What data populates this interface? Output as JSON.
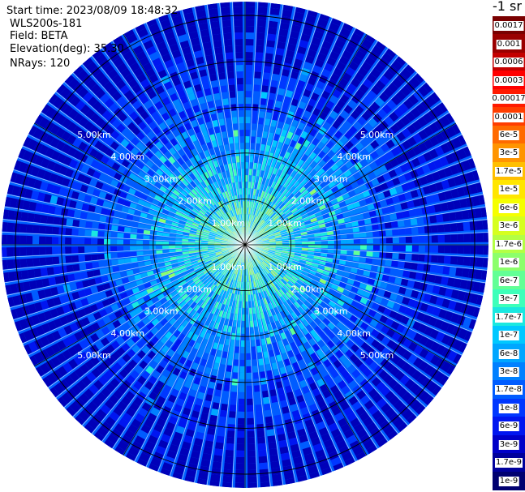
{
  "header": {
    "start_time": "Start time: 2023/08/09 18:48:32",
    "instrument": "WLS200s-181",
    "field": "Field: BETA",
    "elevation": "Elevation(deg): 35.30",
    "nrays": "NRays: 120"
  },
  "chart_data": {
    "type": "heatmap",
    "projection": "polar (PPI)",
    "n_rays": 120,
    "elevation_deg": 35.3,
    "range_km_max": 5.3,
    "ring_labels": [
      "1.00km",
      "2.00km",
      "3.00km",
      "4.00km",
      "5.00km"
    ],
    "grid": true,
    "radial_gridlines_deg_step": 30,
    "radial_profile_note": "backscatter high near radar (cyan/green ~1e-6), decreasing outward to ~1e-8 (blue)",
    "colorbar": {
      "title": "-1 sr",
      "labels": [
        "0.0017",
        "0.001",
        "0.0006",
        "0.0003",
        "0.00017",
        "0.0001",
        "6e-5",
        "3e-5",
        "1.7e-5",
        "1e-5",
        "6e-6",
        "3e-6",
        "1.7e-6",
        "1e-6",
        "6e-7",
        "3e-7",
        "1.7e-7",
        "1e-7",
        "6e-8",
        "3e-8",
        "1.7e-8",
        "1e-8",
        "6e-9",
        "3e-9",
        "1.7e-9",
        "1e-9"
      ],
      "colors": [
        "#7a0000",
        "#9a0000",
        "#c40000",
        "#ff0000",
        "#ff1a00",
        "#ff3d00",
        "#ff6a00",
        "#ff9400",
        "#ffbf00",
        "#ffe600",
        "#f5ff00",
        "#d6ff1f",
        "#b3ff44",
        "#8cff6b",
        "#62ff95",
        "#3dffba",
        "#1ae8e0",
        "#00c8ff",
        "#00a6ff",
        "#0080ff",
        "#005cff",
        "#0037ff",
        "#0016f0",
        "#0000c8",
        "#00009c",
        "#000070"
      ]
    }
  }
}
